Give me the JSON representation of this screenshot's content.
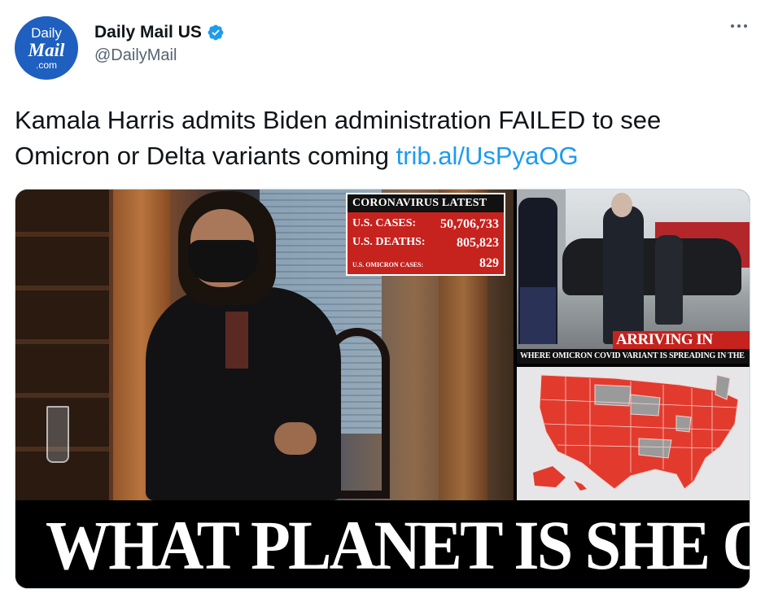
{
  "author": {
    "display_name": "Daily Mail US",
    "handle": "@DailyMail",
    "avatar": {
      "line1": "Daily",
      "line2": "Mail",
      "line3": ".com"
    },
    "verified": true
  },
  "tweet": {
    "text": "Kamala Harris admits Biden administration FAILED to see Omicron or Delta variants coming ",
    "link": "trib.al/UsPyaOG"
  },
  "media": {
    "covid_box": {
      "title": "CORONAVIRUS LATEST",
      "rows": [
        {
          "label": "U.S. CASES:",
          "value": "50,706,733"
        },
        {
          "label": "U.S. DEATHS:",
          "value": "805,823"
        },
        {
          "label": "U.S. OMICRON CASES:",
          "value": "829"
        }
      ]
    },
    "biden_caption": "ARRIVING IN DELAWARE",
    "map_caption": "WHERE OMICRON COVID VARIANT IS SPREADING IN THE US",
    "headline": "WHAT PLANET IS SHE ON?"
  },
  "colors": {
    "link": "#1d9bf0",
    "text": "#0f1419",
    "muted": "#536471",
    "verified": "#1d9bf0",
    "brand_red": "#c6221e",
    "map_red": "#e23b2e",
    "map_grey": "#9a9a9a"
  },
  "icons": {
    "verified": "verified-badge-icon",
    "more": "more-horizontal-icon"
  }
}
